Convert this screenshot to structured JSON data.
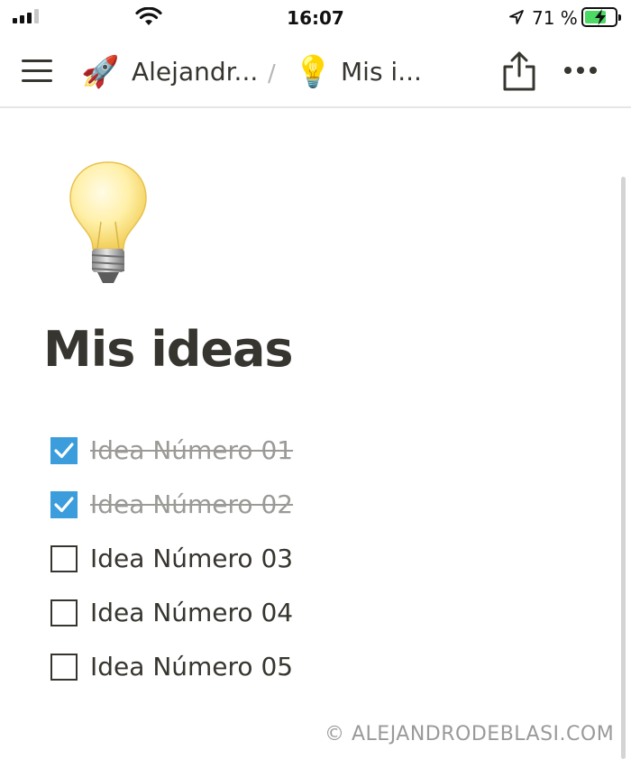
{
  "status_bar": {
    "time": "16:07",
    "battery_percent": "71 %",
    "battery_level": 0.71,
    "battery_color": "#4cd964",
    "icons": [
      "cellular-signal-icon",
      "wifi-icon",
      "location-arrow-icon",
      "battery-charging-icon"
    ]
  },
  "nav": {
    "menu_icon": "hamburger-menu-icon",
    "breadcrumb": [
      {
        "emoji": "🚀",
        "label": "Alejandr..."
      },
      {
        "emoji": "💡",
        "label": "Mis i..."
      }
    ],
    "separator": "/",
    "actions": [
      "share-icon",
      "more-icon"
    ]
  },
  "page": {
    "icon": "lightbulb-icon",
    "title": "Mis ideas",
    "todos": [
      {
        "label": "Idea Número 01",
        "checked": true
      },
      {
        "label": "Idea Número 02",
        "checked": true
      },
      {
        "label": "Idea Número 03",
        "checked": false
      },
      {
        "label": "Idea Número 04",
        "checked": false
      },
      {
        "label": "Idea Número 05",
        "checked": false
      }
    ],
    "checkbox_color": "#3b9ddb"
  },
  "watermark": "© ALEJANDRODEBLASI.COM"
}
